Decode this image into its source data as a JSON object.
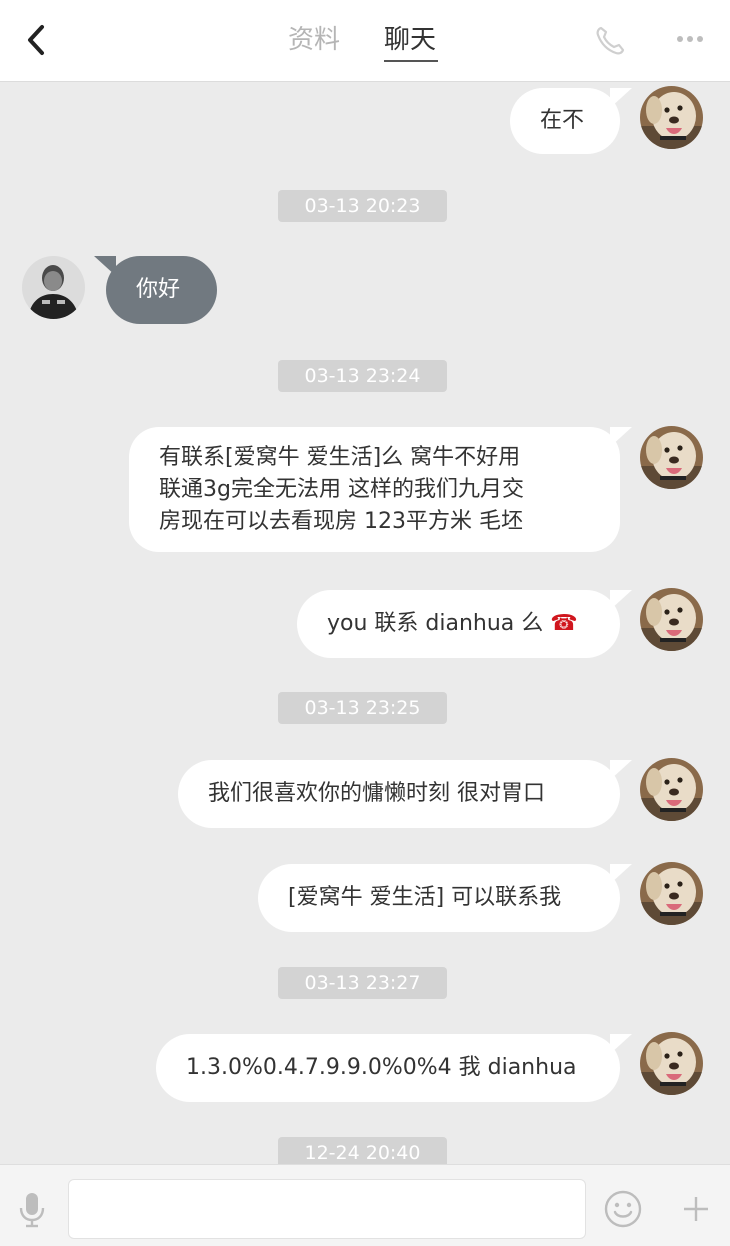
{
  "header": {
    "tabs": [
      {
        "label": "资料",
        "active": false
      },
      {
        "label": "聊天",
        "active": true
      }
    ],
    "icons": [
      "back-chevron-icon",
      "phone-icon",
      "more-icon"
    ]
  },
  "messages": [
    {
      "type": "outgoing",
      "text": "在不"
    },
    {
      "type": "timestamp",
      "text": "03-13 20:23"
    },
    {
      "type": "incoming",
      "text": "你好"
    },
    {
      "type": "timestamp",
      "text": "03-13 23:24"
    },
    {
      "type": "outgoing",
      "text": "有联系[爱窝牛 爱生活]么 窝牛不好用\n联通3g完全无法用 这样的我们九月交\n房现在可以去看现房 123平方米 毛坯"
    },
    {
      "type": "outgoing",
      "text": "you 联系 dianhua 么 ☎"
    },
    {
      "type": "timestamp",
      "text": "03-13 23:25"
    },
    {
      "type": "outgoing",
      "text": "我们很喜欢你的慵懒时刻 很对胃口"
    },
    {
      "type": "outgoing",
      "text": "[爱窝牛 爱生活] 可以联系我"
    },
    {
      "type": "timestamp",
      "text": "03-13 23:27"
    },
    {
      "type": "outgoing",
      "text": "1.3.0%0.4.7.9.9.0%0%4 我 dianhua"
    },
    {
      "type": "timestamp",
      "text": "12-24 20:40"
    }
  ],
  "input_bar": {
    "value": "",
    "placeholder": "",
    "icons": [
      "microphone-icon",
      "emoji-icon",
      "plus-icon"
    ]
  },
  "colors": {
    "chat_background": "#ebebeb",
    "outgoing_bubble": "#ffffff",
    "incoming_bubble": "#717980",
    "timestamp_pill": "#d3d3d3",
    "phone_emoji": "#d0161e"
  }
}
